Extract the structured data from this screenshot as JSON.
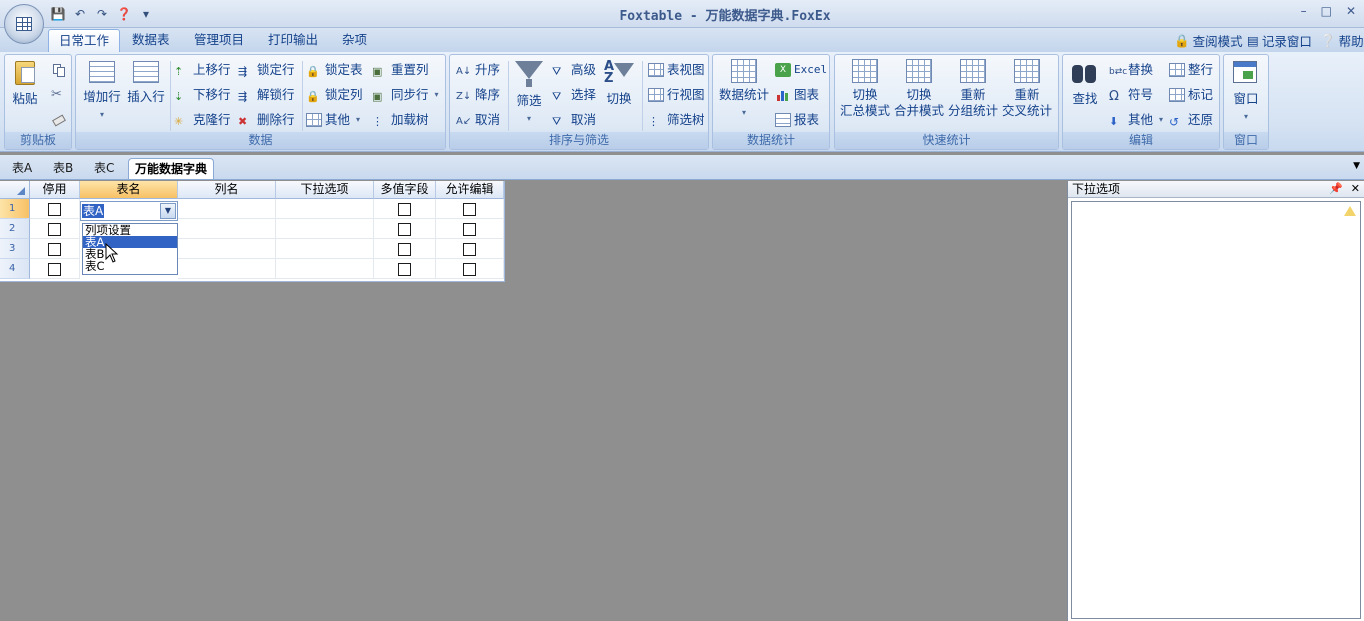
{
  "window": {
    "title": "Foxtable - 万能数据字典.FoxEx",
    "controls": [
      "–",
      "□",
      "✕"
    ]
  },
  "ribbon_tabs": [
    "日常工作",
    "数据表",
    "管理项目",
    "打印输出",
    "杂项"
  ],
  "ribbon_right": {
    "view_mode": "查阅模式",
    "log_window": "记录窗口",
    "help": "帮助"
  },
  "groups": {
    "clipboard": {
      "caption": "剪贴板",
      "paste": "粘贴"
    },
    "data": {
      "caption": "数据",
      "add_row": "增加行",
      "insert_row": "插入行",
      "move_up": "上移行",
      "move_down": "下移行",
      "clone_row": "克隆行",
      "lock_row": "锁定行",
      "unlock_row": "解锁行",
      "delete_row": "删除行",
      "lock_table": "锁定表",
      "lock_col": "锁定列",
      "other": "其他",
      "reset_col": "重置列",
      "sync_row": "同步行",
      "load_tree": "加载树"
    },
    "sort_filter": {
      "caption": "排序与筛选",
      "asc": "升序",
      "desc": "降序",
      "cancel": "取消",
      "filter": "筛选",
      "advanced": "高级",
      "select": "选择",
      "cancel2": "取消",
      "toggle": "切换",
      "table_view": "表视图",
      "row_view": "行视图",
      "filter_tree": "筛选树"
    },
    "stats": {
      "caption": "数据统计",
      "data_stats": "数据统计",
      "excel": "Excel",
      "chart": "图表",
      "report": "报表"
    },
    "quick_stats": {
      "caption": "快速统计",
      "b1_line1": "切换",
      "b1_line2": "汇总模式",
      "b2_line1": "切换",
      "b2_line2": "合并模式",
      "b3_line1": "重新",
      "b3_line2": "分组统计",
      "b4_line1": "重新",
      "b4_line2": "交叉统计"
    },
    "edit": {
      "caption": "编辑",
      "find": "查找",
      "replace": "替换",
      "symbol": "符号",
      "other": "其他",
      "whole_row": "整行",
      "mark": "标记",
      "restore": "还原"
    },
    "window": {
      "caption": "窗口",
      "window": "窗口"
    }
  },
  "sheet_tabs": [
    "表A",
    "表B",
    "表C",
    "万能数据字典"
  ],
  "grid": {
    "columns": [
      "停用",
      "表名",
      "列名",
      "下拉选项",
      "多值字段",
      "允许编辑"
    ],
    "rows": [
      "1",
      "2",
      "3",
      "4"
    ],
    "editor_value": "表A",
    "dropdown_items": [
      "列项设置",
      "表A",
      "表B",
      "表C"
    ]
  },
  "right_panel": {
    "title": "下拉选项"
  }
}
